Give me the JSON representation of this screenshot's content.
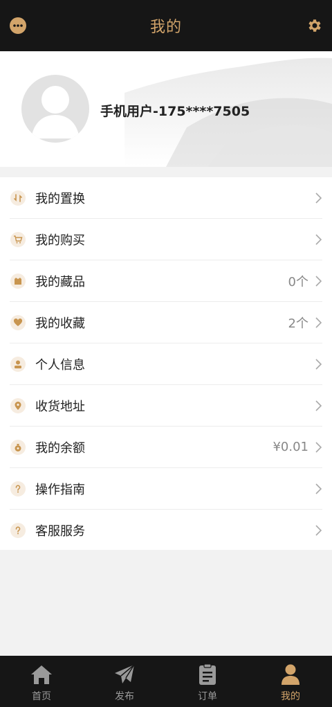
{
  "header": {
    "title": "我的",
    "more_icon": "more-dots-icon",
    "settings_icon": "gear-icon",
    "accent_color": "#d2a46a"
  },
  "profile": {
    "username": "手机用户-175****7505",
    "avatar_icon": "default-avatar-icon"
  },
  "menu": {
    "items": [
      {
        "label": "我的置换",
        "value": "",
        "icon": "exchange-icon"
      },
      {
        "label": "我的购买",
        "value": "",
        "icon": "cart-icon"
      },
      {
        "label": "我的藏品",
        "value": "0个",
        "icon": "collection-icon"
      },
      {
        "label": "我的收藏",
        "value": "2个",
        "icon": "heart-icon"
      },
      {
        "label": "个人信息",
        "value": "",
        "icon": "person-icon"
      },
      {
        "label": "收货地址",
        "value": "",
        "icon": "location-icon"
      },
      {
        "label": "我的余额",
        "value": "¥0.01",
        "icon": "money-bag-icon"
      },
      {
        "label": "操作指南",
        "value": "",
        "icon": "question-icon"
      },
      {
        "label": "客服服务",
        "value": "",
        "icon": "question-icon"
      }
    ]
  },
  "tabbar": {
    "tabs": [
      {
        "label": "首页",
        "icon": "home-icon",
        "active": false
      },
      {
        "label": "发布",
        "icon": "send-icon",
        "active": false
      },
      {
        "label": "订单",
        "icon": "clipboard-icon",
        "active": false
      },
      {
        "label": "我的",
        "icon": "user-icon",
        "active": true
      }
    ]
  }
}
